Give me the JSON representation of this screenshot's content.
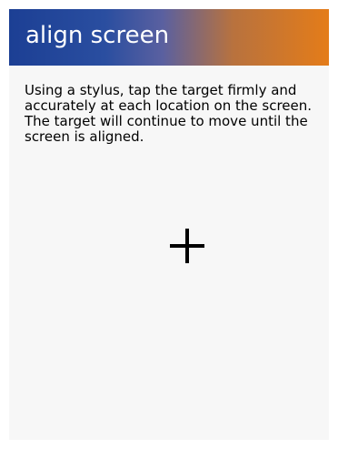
{
  "title_bar": {
    "title": "align screen"
  },
  "instructions": {
    "text": "Using a stylus, tap the target firmly and accurately at each location on the screen. The target will continue to move until the screen is aligned."
  },
  "target": {
    "icon": "crosshair-target-icon",
    "color": "#000000"
  },
  "colors": {
    "title_gradient_start": "#1c3f94",
    "title_gradient_end": "#e47c19",
    "background": "#f7f7f7"
  }
}
